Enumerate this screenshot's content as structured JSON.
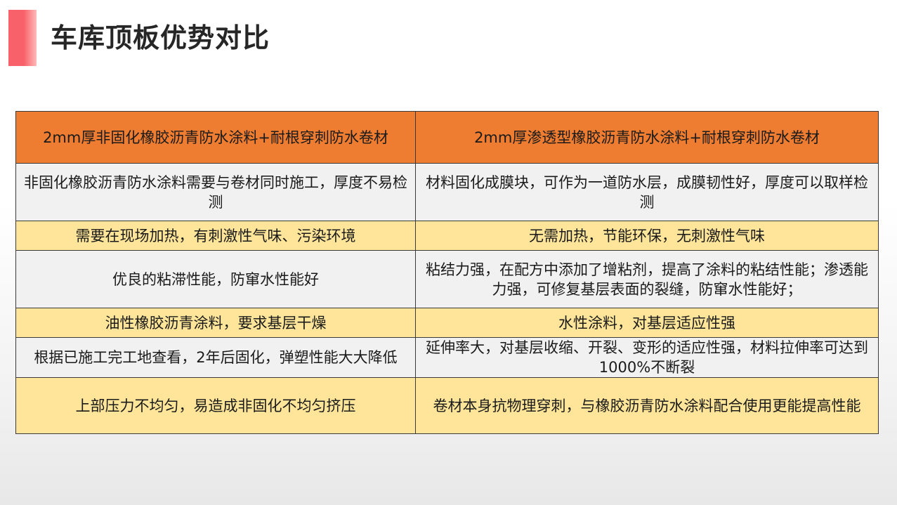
{
  "slide": {
    "title": "车库顶板优势对比"
  },
  "table": {
    "headers": [
      "2mm厚非固化橡胶沥青防水涂料+耐根穿刺防水卷材",
      "2mm厚渗透型橡胶沥青防水涂料+耐根穿刺防水卷材"
    ],
    "rows": [
      {
        "left": "非固化橡胶沥青防水涂料需要与卷材同时施工，厚度不易检测",
        "right": "材料固化成膜块，可作为一道防水层，成膜韧性好，厚度可以取样检测"
      },
      {
        "left": "需要在现场加热，有刺激性气味、污染环境",
        "right": "无需加热，节能环保，无刺激性气味"
      },
      {
        "left": "优良的粘滞性能，防窜水性能好",
        "right": "粘结力强，在配方中添加了增粘剂，提高了涂料的粘结性能；渗透能力强，可修复基层表面的裂缝，防窜水性能好；"
      },
      {
        "left": "油性橡胶沥青涂料，要求基层干燥",
        "right": "水性涂料，对基层适应性强"
      },
      {
        "left": "根据已施工完工地查看，2年后固化，弹塑性能大大降低",
        "right": "延伸率大，对基层收缩、开裂、变形的适应性强，材料拉伸率可达到1000%不断裂"
      },
      {
        "left": "上部压力不均匀，易造成非固化不均匀挤压",
        "right": "卷材本身抗物理穿刺，与橡胶沥青防水涂料配合使用更能提高性能"
      }
    ]
  },
  "colors": {
    "header_bg": "#ee7d31",
    "row_gray": "#f1f1f1",
    "row_yellow": "#fee599",
    "accent": "#f8616a"
  }
}
